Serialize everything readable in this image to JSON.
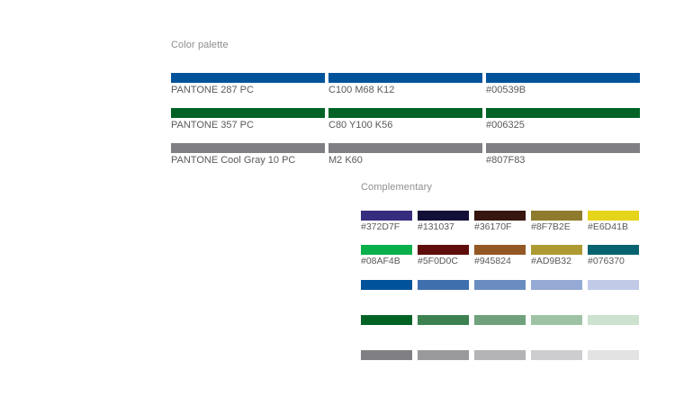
{
  "palette": {
    "heading": "Color palette",
    "rows": [
      {
        "color": "#00539B",
        "cells": [
          {
            "label": "PANTONE 287 PC"
          },
          {
            "label": "C100 M68 K12"
          },
          {
            "label": "#00539B"
          }
        ]
      },
      {
        "color": "#006325",
        "cells": [
          {
            "label": "PANTONE 357 PC"
          },
          {
            "label": "C80 Y100 K56"
          },
          {
            "label": "#006325"
          }
        ]
      },
      {
        "color": "#807F83",
        "cells": [
          {
            "label": "PANTONE Cool Gray 10 PC"
          },
          {
            "label": "M2 K60"
          },
          {
            "label": "#807F83"
          }
        ]
      }
    ]
  },
  "complementary": {
    "heading": "Complementary",
    "rows": [
      {
        "swatches": [
          {
            "color": "#372D7F",
            "label": "#372D7F"
          },
          {
            "color": "#131037",
            "label": "#131037"
          },
          {
            "color": "#36170F",
            "label": "#36170F"
          },
          {
            "color": "#8F7B2E",
            "label": "#8F7B2E"
          },
          {
            "color": "#E6D41B",
            "label": "#E6D41B"
          }
        ]
      },
      {
        "swatches": [
          {
            "color": "#08AF4B",
            "label": "#08AF4B"
          },
          {
            "color": "#5F0D0C",
            "label": "#5F0D0C"
          },
          {
            "color": "#945824",
            "label": "#945824"
          },
          {
            "color": "#AD9B32",
            "label": "#AD9B32"
          },
          {
            "color": "#076370",
            "label": "#076370"
          }
        ]
      },
      {
        "swatches": [
          {
            "color": "#00539B"
          },
          {
            "color": "#3F6FAE"
          },
          {
            "color": "#6A8DC1"
          },
          {
            "color": "#94AAD4"
          },
          {
            "color": "#C1CBE8"
          }
        ]
      },
      {
        "swatches": [
          {
            "color": "#006325"
          },
          {
            "color": "#3C8251"
          },
          {
            "color": "#6FA27C"
          },
          {
            "color": "#9EC3A4"
          },
          {
            "color": "#CDE1CF"
          }
        ]
      },
      {
        "swatches": [
          {
            "color": "#807F83"
          },
          {
            "color": "#9A999C"
          },
          {
            "color": "#B4B3B5"
          },
          {
            "color": "#CDCCCE"
          },
          {
            "color": "#E4E3E4"
          }
        ]
      }
    ]
  }
}
